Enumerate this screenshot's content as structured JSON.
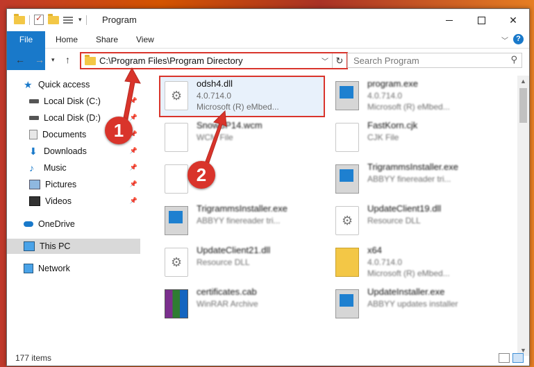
{
  "window": {
    "title": "Program"
  },
  "ribbon": {
    "tabs": [
      "File",
      "Home",
      "Share",
      "View"
    ],
    "help_label": "?"
  },
  "nav": {
    "back_icon": "arrow-left-icon",
    "forward_icon": "arrow-right-icon",
    "address_path": "C:\\Program Files\\Program Directory",
    "search_placeholder": "Search Program"
  },
  "sidebar": {
    "items": [
      {
        "label": "Quick access",
        "icon": "star-icon"
      },
      {
        "label": "Local Disk (C:)",
        "icon": "drive-icon",
        "pinned": true
      },
      {
        "label": "Local Disk (D:)",
        "icon": "drive-icon",
        "pinned": true
      },
      {
        "label": "Documents",
        "icon": "documents-icon",
        "pinned": true
      },
      {
        "label": "Downloads",
        "icon": "download-icon",
        "pinned": true
      },
      {
        "label": "Music",
        "icon": "music-icon",
        "pinned": true
      },
      {
        "label": "Pictures",
        "icon": "pictures-icon",
        "pinned": true
      },
      {
        "label": "Videos",
        "icon": "videos-icon",
        "pinned": true
      },
      {
        "label": "OneDrive",
        "icon": "cloud-icon"
      },
      {
        "label": "This PC",
        "icon": "monitor-icon",
        "selected": true
      },
      {
        "label": "Network",
        "icon": "network-icon"
      }
    ]
  },
  "files": [
    {
      "name": "odsh4.dll",
      "meta1": "4.0.714.0",
      "meta2": "Microsoft (R) eMbed...",
      "icon": "dll-gear-icon",
      "highlighted": true
    },
    {
      "name": "program.exe",
      "meta1": "4.0.714.0",
      "meta2": "Microsoft (R) eMbed...",
      "icon": "exe-icon"
    },
    {
      "name": "SnowBP14.wcm",
      "meta1": "WCM File",
      "meta2": "",
      "icon": "blank-file-icon"
    },
    {
      "name": "FastKorn.cjk",
      "meta1": "CJK File",
      "meta2": "",
      "icon": "blank-file-icon"
    },
    {
      "name": "",
      "meta1": "",
      "meta2": "",
      "icon": "blank-file-icon"
    },
    {
      "name": "TrigrammsInstaller.exe",
      "meta1": "ABBYY finereader tri...",
      "meta2": "",
      "icon": "installer-icon"
    },
    {
      "name": "TrigrammsInstaller.exe",
      "meta1": "ABBYY finereader tri...",
      "meta2": "",
      "icon": "installer-icon"
    },
    {
      "name": "UpdateClient19.dll",
      "meta1": "Resource DLL",
      "meta2": "",
      "icon": "dll-gear-icon"
    },
    {
      "name": "UpdateClient21.dll",
      "meta1": "Resource DLL",
      "meta2": "",
      "icon": "dll-gear-icon"
    },
    {
      "name": "x64",
      "meta1": "4.0.714.0",
      "meta2": "Microsoft (R) eMbed...",
      "icon": "zip-icon"
    },
    {
      "name": "certificates.cab",
      "meta1": "WinRAR Archive",
      "meta2": "",
      "icon": "winrar-icon"
    },
    {
      "name": "UpdateInstaller.exe",
      "meta1": "ABBYY updates installer",
      "meta2": "",
      "icon": "installer-icon"
    }
  ],
  "status": {
    "count": "177 items"
  },
  "annotations": {
    "step1": "1",
    "step2": "2"
  },
  "colors": {
    "accent": "#1979ca",
    "annotation": "#d9342b"
  }
}
